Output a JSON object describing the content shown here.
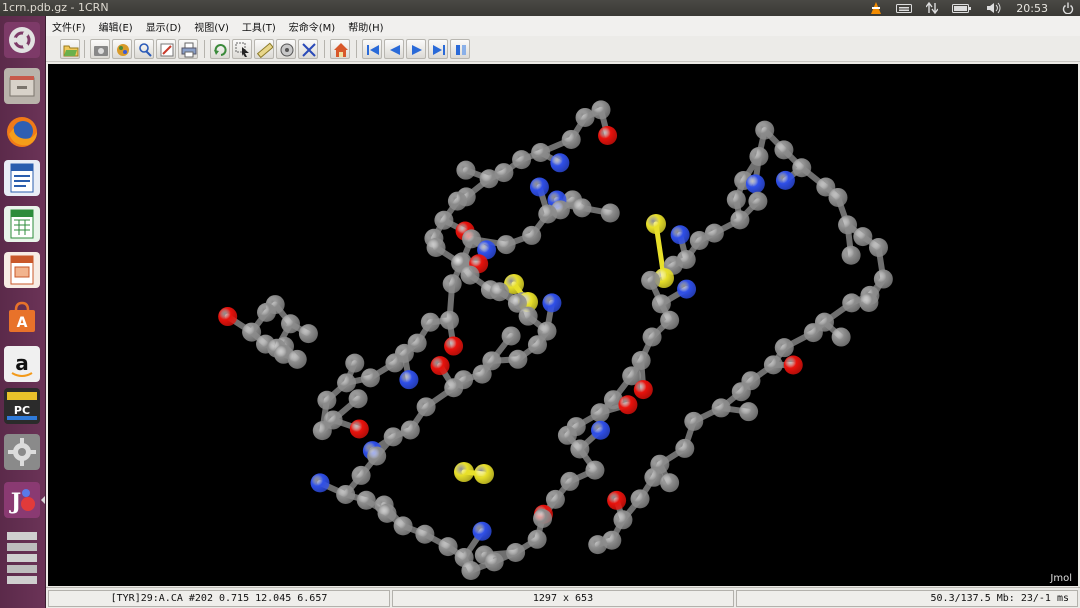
{
  "window": {
    "title": "1crn.pdb.gz - 1CRN"
  },
  "top_panel": {
    "time": "20:53",
    "tray_icons": [
      "vlc-icon",
      "keyboard-icon",
      "network-icon",
      "battery-icon",
      "volume-icon",
      "power-icon"
    ]
  },
  "launcher": {
    "items": [
      "ubuntu-dash-icon",
      "files-icon",
      "firefox-icon",
      "writer-icon",
      "calc-icon",
      "impress-icon",
      "software-center-icon",
      "amazon-icon",
      "pcman-icon",
      "settings-icon",
      "jmol-icon",
      "workspaces-icon"
    ]
  },
  "menubar": {
    "file": "文件(F)",
    "edit": "编辑(E)",
    "display": "显示(D)",
    "view": "视图(V)",
    "tools": "工具(T)",
    "macros": "宏命令(M)",
    "help": "帮助(H)"
  },
  "viewer": {
    "watermark": "Jmol",
    "colors": {
      "carbon": "#8c8c8c",
      "oxygen": "#e8120c",
      "nitrogen": "#2f4fe8",
      "sulfur": "#e8e02a",
      "background": "#000000"
    }
  },
  "statusbar": {
    "atom_info": "[TYR]29:A.CA #202 0.715 12.045 6.657",
    "dimensions": "1297 x 653",
    "memory": "50.3/137.5 Mb:  23/-1 ms"
  }
}
